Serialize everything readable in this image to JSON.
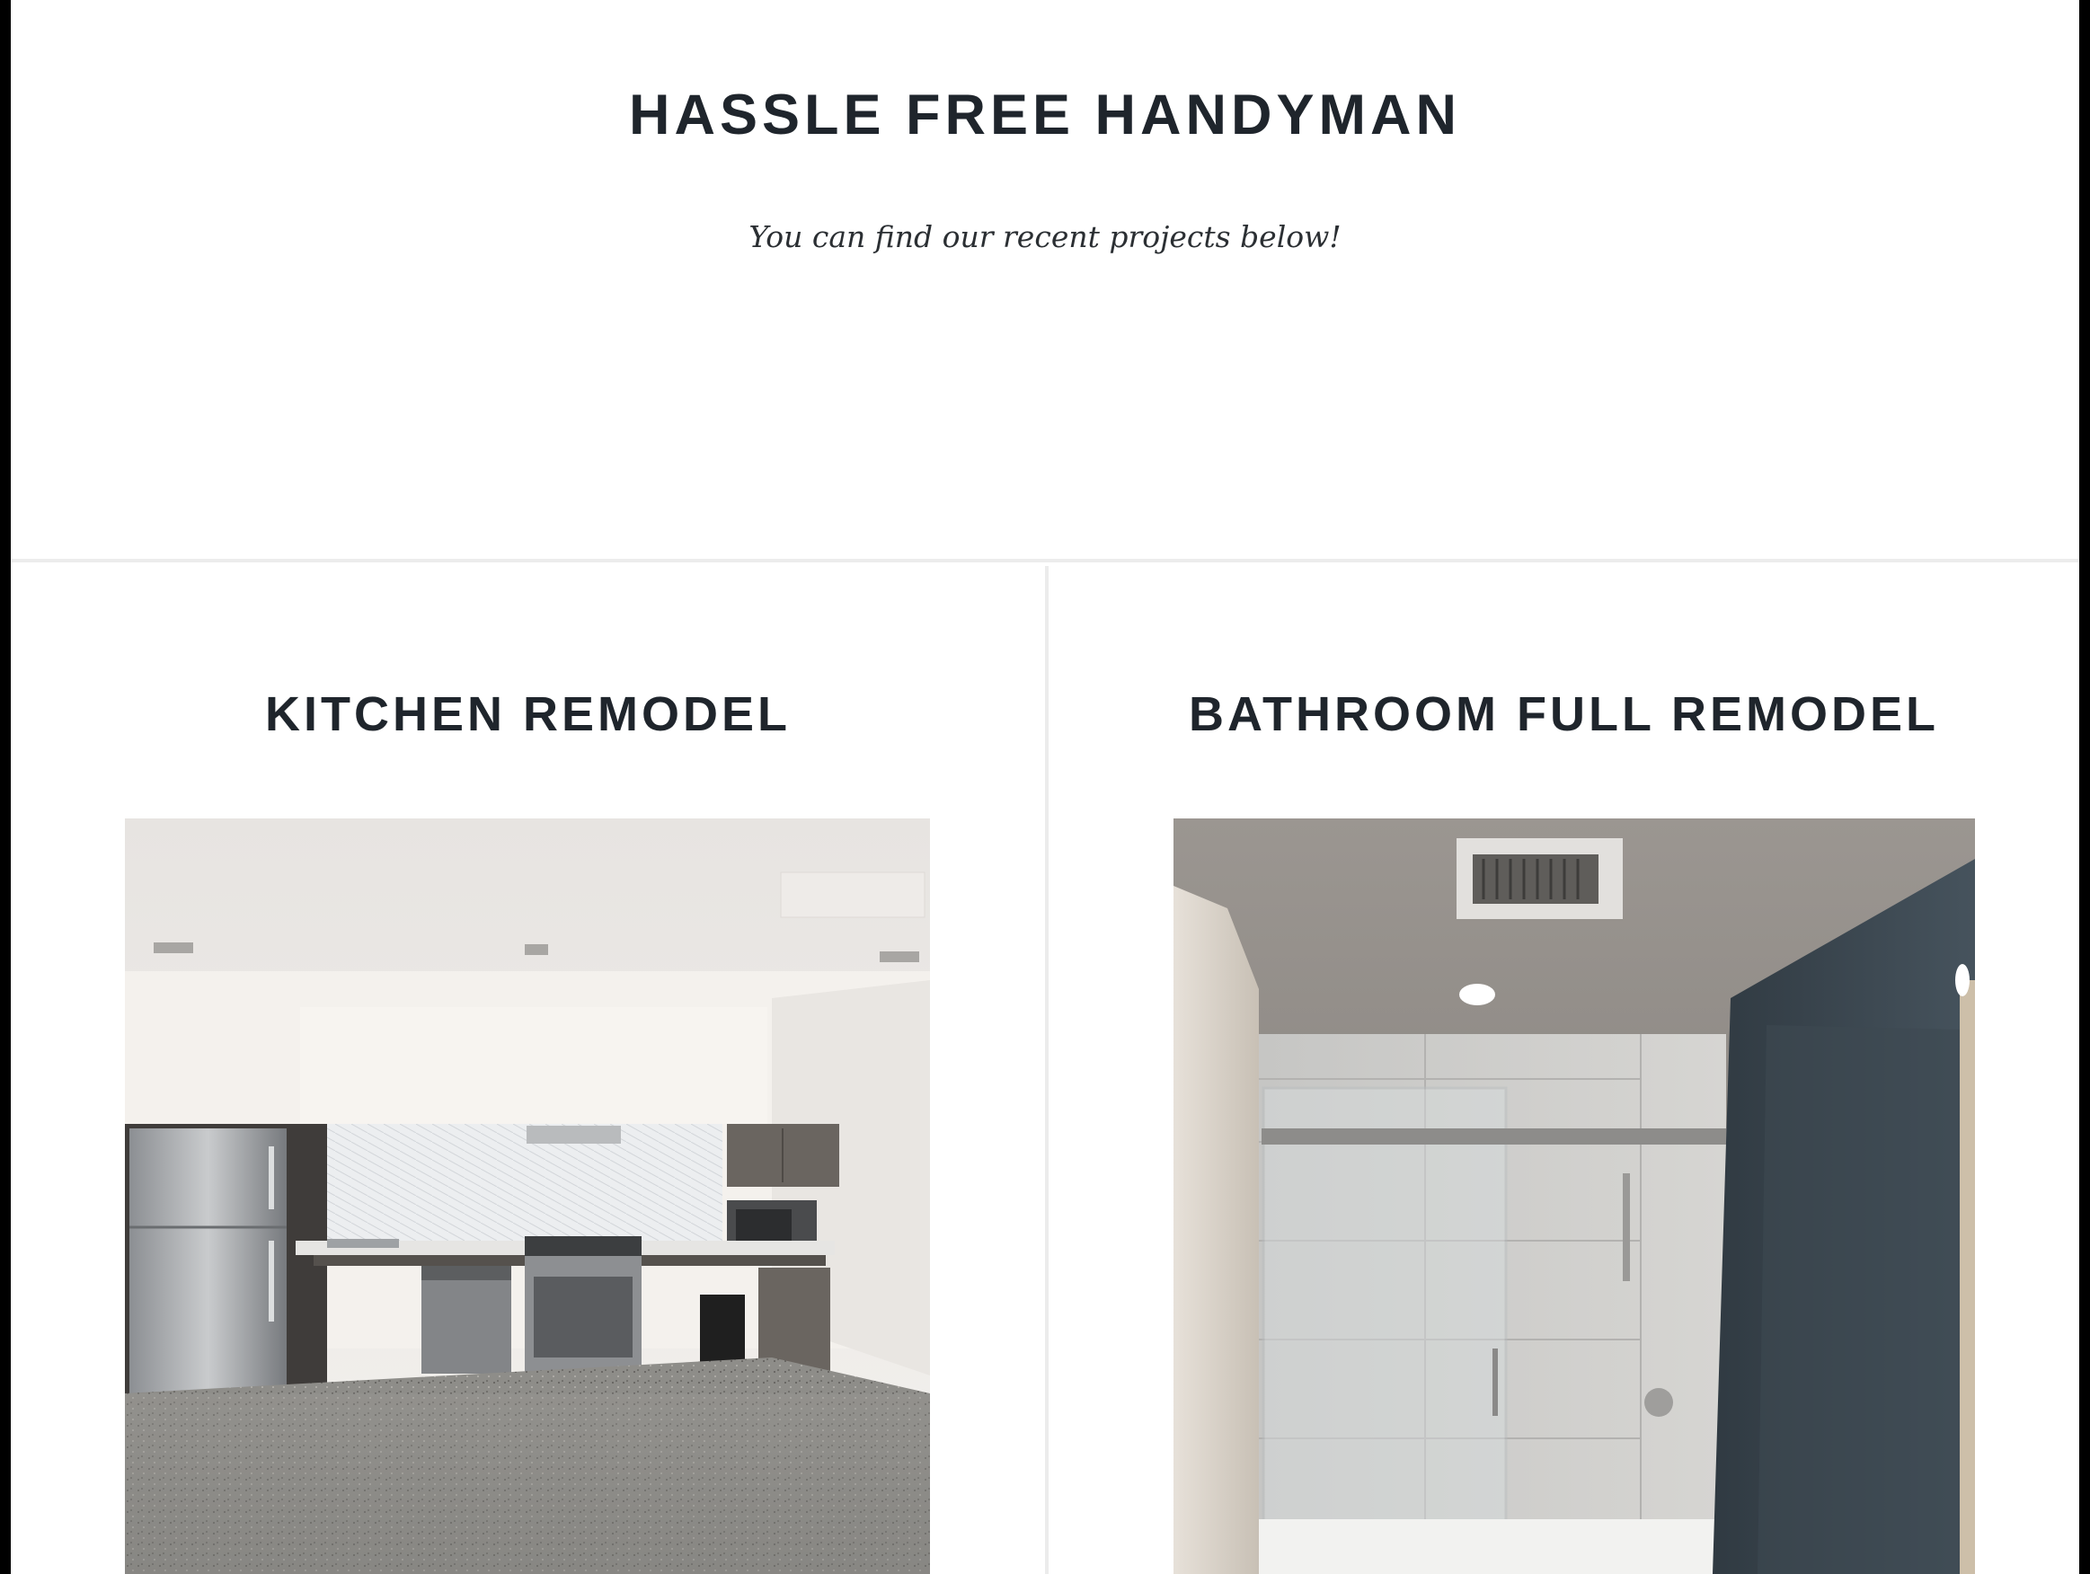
{
  "header": {
    "site_title": "HASSLE FREE HANDYMAN",
    "tagline": "You can find our recent projects below!"
  },
  "projects": [
    {
      "title": "KITCHEN REMODEL",
      "photo_icon": "kitchen-photo"
    },
    {
      "title": "BATHROOM FULL REMODEL",
      "photo_icon": "bathroom-photo"
    }
  ],
  "colors": {
    "background": "#ffffff",
    "heading": "#1f252c",
    "divider": "#ececec"
  }
}
